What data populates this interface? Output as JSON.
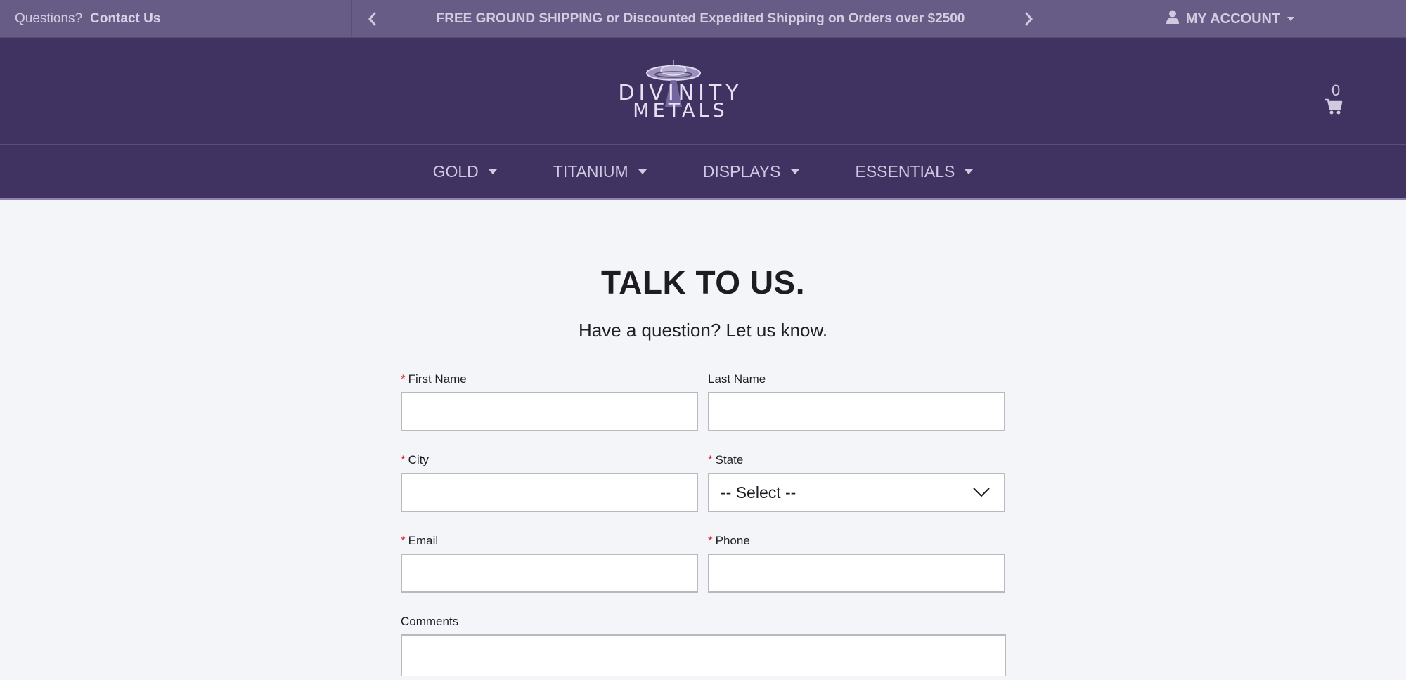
{
  "topbar": {
    "questions_label": "Questions?",
    "contact_link": "Contact Us",
    "promo_text": "FREE GROUND SHIPPING or Discounted Expedited Shipping on Orders over $2500",
    "account_label": "MY ACCOUNT",
    "prev_icon": "chevron-left-icon",
    "next_icon": "chevron-right-icon",
    "account_icon": "user-icon"
  },
  "header": {
    "logo_line1": "DIVINITY",
    "logo_line2": "METALS",
    "cart_count": "0",
    "cart_icon": "cart-icon"
  },
  "nav": {
    "items": [
      {
        "label": "GOLD"
      },
      {
        "label": "TITANIUM"
      },
      {
        "label": "DISPLAYS"
      },
      {
        "label": "ESSENTIALS"
      }
    ]
  },
  "main": {
    "title": "TALK TO US.",
    "subtitle": "Have a question? Let us know."
  },
  "form": {
    "required_marker": "*",
    "first_name": {
      "label": "First Name",
      "value": "",
      "required": true
    },
    "last_name": {
      "label": "Last Name",
      "value": "",
      "required": false
    },
    "city": {
      "label": "City",
      "value": "",
      "required": true
    },
    "state": {
      "label": "State",
      "selected": "-- Select --",
      "required": true
    },
    "email": {
      "label": "Email",
      "value": "",
      "required": true
    },
    "phone": {
      "label": "Phone",
      "value": "",
      "required": true
    },
    "comments": {
      "label": "Comments",
      "value": "",
      "required": false
    }
  },
  "colors": {
    "topbar_bg": "#675c85",
    "header_bg": "#403361",
    "page_bg": "#f4f5f9",
    "required": "#d9262e"
  }
}
